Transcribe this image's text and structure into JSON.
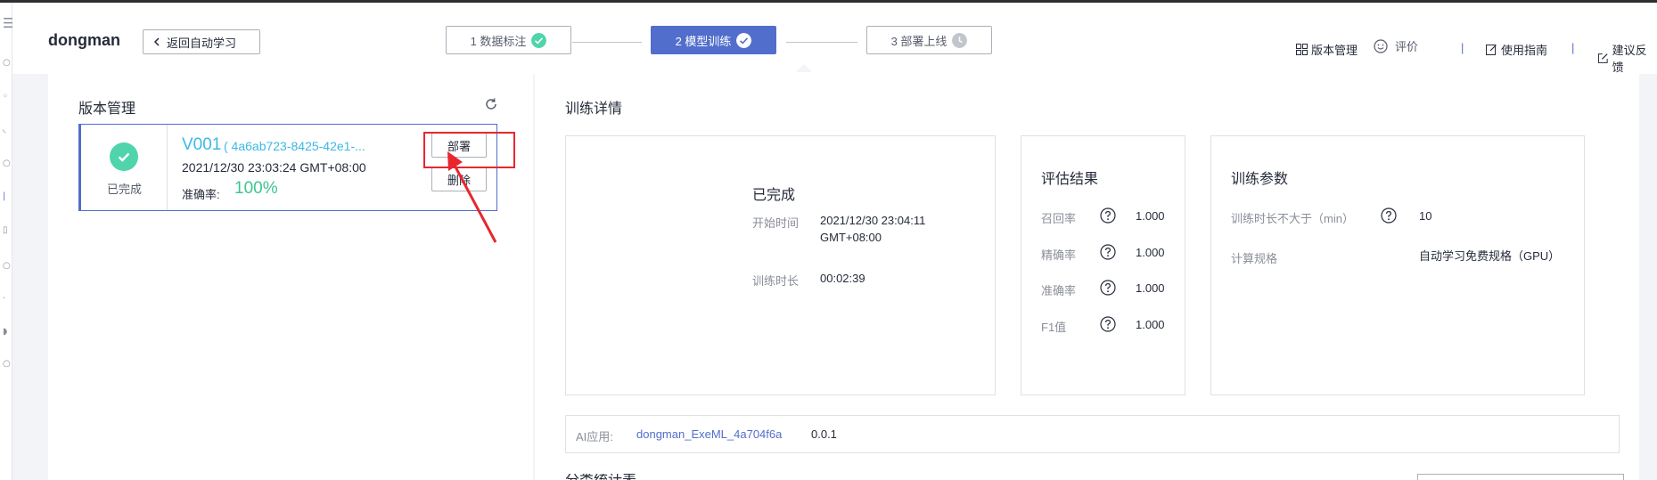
{
  "header": {
    "app_title": "dongman",
    "back_label": "返回自动学习",
    "steps": [
      {
        "label": "1 数据标注",
        "state": "done"
      },
      {
        "label": "2 模型训练",
        "state": "active"
      },
      {
        "label": "3 部署上线",
        "state": "pending"
      }
    ],
    "links": {
      "version_mgmt": "版本管理",
      "rate": "评价",
      "guide": "使用指南",
      "feedback": "建议反馈"
    },
    "sep": "|"
  },
  "left_panel": {
    "title": "版本管理",
    "version": {
      "status": "已完成",
      "name": "V001",
      "id": "( 4a6ab723-8425-42e1-...",
      "time": "2021/12/30 23:03:24 GMT+08:00",
      "accuracy_label": "准确率:",
      "accuracy_value": "100%",
      "deploy_label": "部署",
      "delete_label": "删除"
    }
  },
  "right_panel": {
    "title": "训练详情",
    "status": {
      "title": "已完成",
      "start_label": "开始时间",
      "start_value_line1": "2021/12/30 23:04:11",
      "start_value_line2": "GMT+08:00",
      "duration_label": "训练时长",
      "duration_value": "00:02:39"
    },
    "eval": {
      "title": "评估结果",
      "rows": [
        {
          "label": "召回率",
          "value": "1.000"
        },
        {
          "label": "精确率",
          "value": "1.000"
        },
        {
          "label": "准确率",
          "value": "1.000"
        },
        {
          "label": "F1值",
          "value": "1.000"
        }
      ]
    },
    "params": {
      "title": "训练参数",
      "max_duration_label": "训练时长不大于（min）",
      "max_duration_value": "10",
      "spec_label": "计算规格",
      "spec_value": "自动学习免费规格（GPU）"
    },
    "ai_app": {
      "label": "AI应用:",
      "name": "dongman_ExeML_4a704f6a",
      "version": "0.0.1"
    },
    "next_title": "分类统计表"
  },
  "colors": {
    "primary": "#526ecc",
    "success": "#50d4ab",
    "accent_text": "#3bb9e3",
    "accuracy": "#3fc58f",
    "annotation_red": "#e8262d"
  }
}
